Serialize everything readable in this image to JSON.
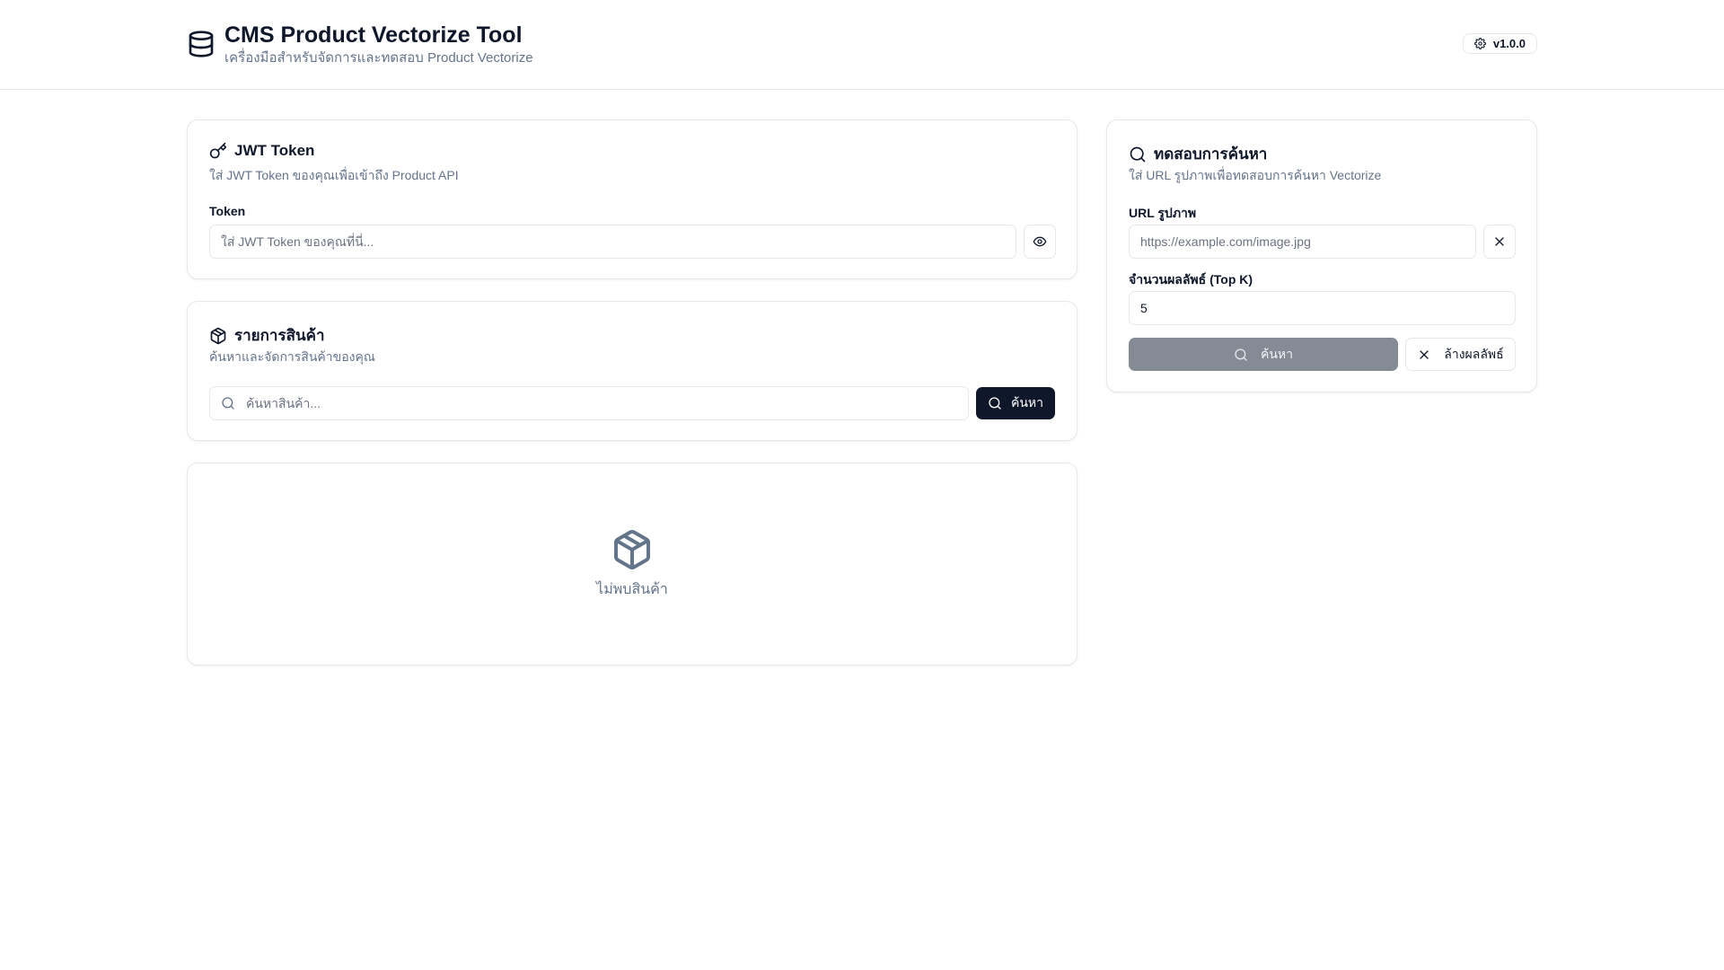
{
  "header": {
    "title": "CMS Product Vectorize Tool",
    "subtitle": "เครื่องมือสำหรับจัดการและทดสอบ Product Vectorize",
    "version": "v1.0.0",
    "logo_icon": "database-icon",
    "version_icon": "gear-icon"
  },
  "jwt_card": {
    "title": "JWT Token",
    "icon": "key-icon",
    "description": "ใส่ JWT Token ของคุณเพื่อเข้าถึง Product API",
    "token_label": "Token",
    "token_placeholder": "ใส่ JWT Token ของคุณที่นี่...",
    "token_value": "",
    "toggle_icon": "eye-icon"
  },
  "products_card": {
    "title": "รายการสินค้า",
    "icon": "package-icon",
    "description": "ค้นหาและจัดการสินค้าของคุณ",
    "search_placeholder": "ค้นหาสินค้า...",
    "search_value": "",
    "search_button": "ค้นหา"
  },
  "empty_state": {
    "icon": "package-icon",
    "text": "ไม่พบสินค้า"
  },
  "search_test_card": {
    "title": "ทดสอบการค้นหา",
    "icon": "search-icon",
    "description": "ใส่ URL รูปภาพเพื่อทดสอบการค้นหา Vectorize",
    "url_label": "URL รูปภาพ",
    "url_placeholder": "https://example.com/image.jpg",
    "url_value": "",
    "topk_label": "จำนวนผลลัพธ์ (Top K)",
    "topk_value": "5",
    "search_button": "ค้นหา",
    "clear_button": "ล้างผลลัพธ์"
  },
  "colors": {
    "primary_dark": "#0f172a",
    "muted_text": "#64748b",
    "border": "#e5e7eb",
    "disabled_button": "#858b95"
  }
}
